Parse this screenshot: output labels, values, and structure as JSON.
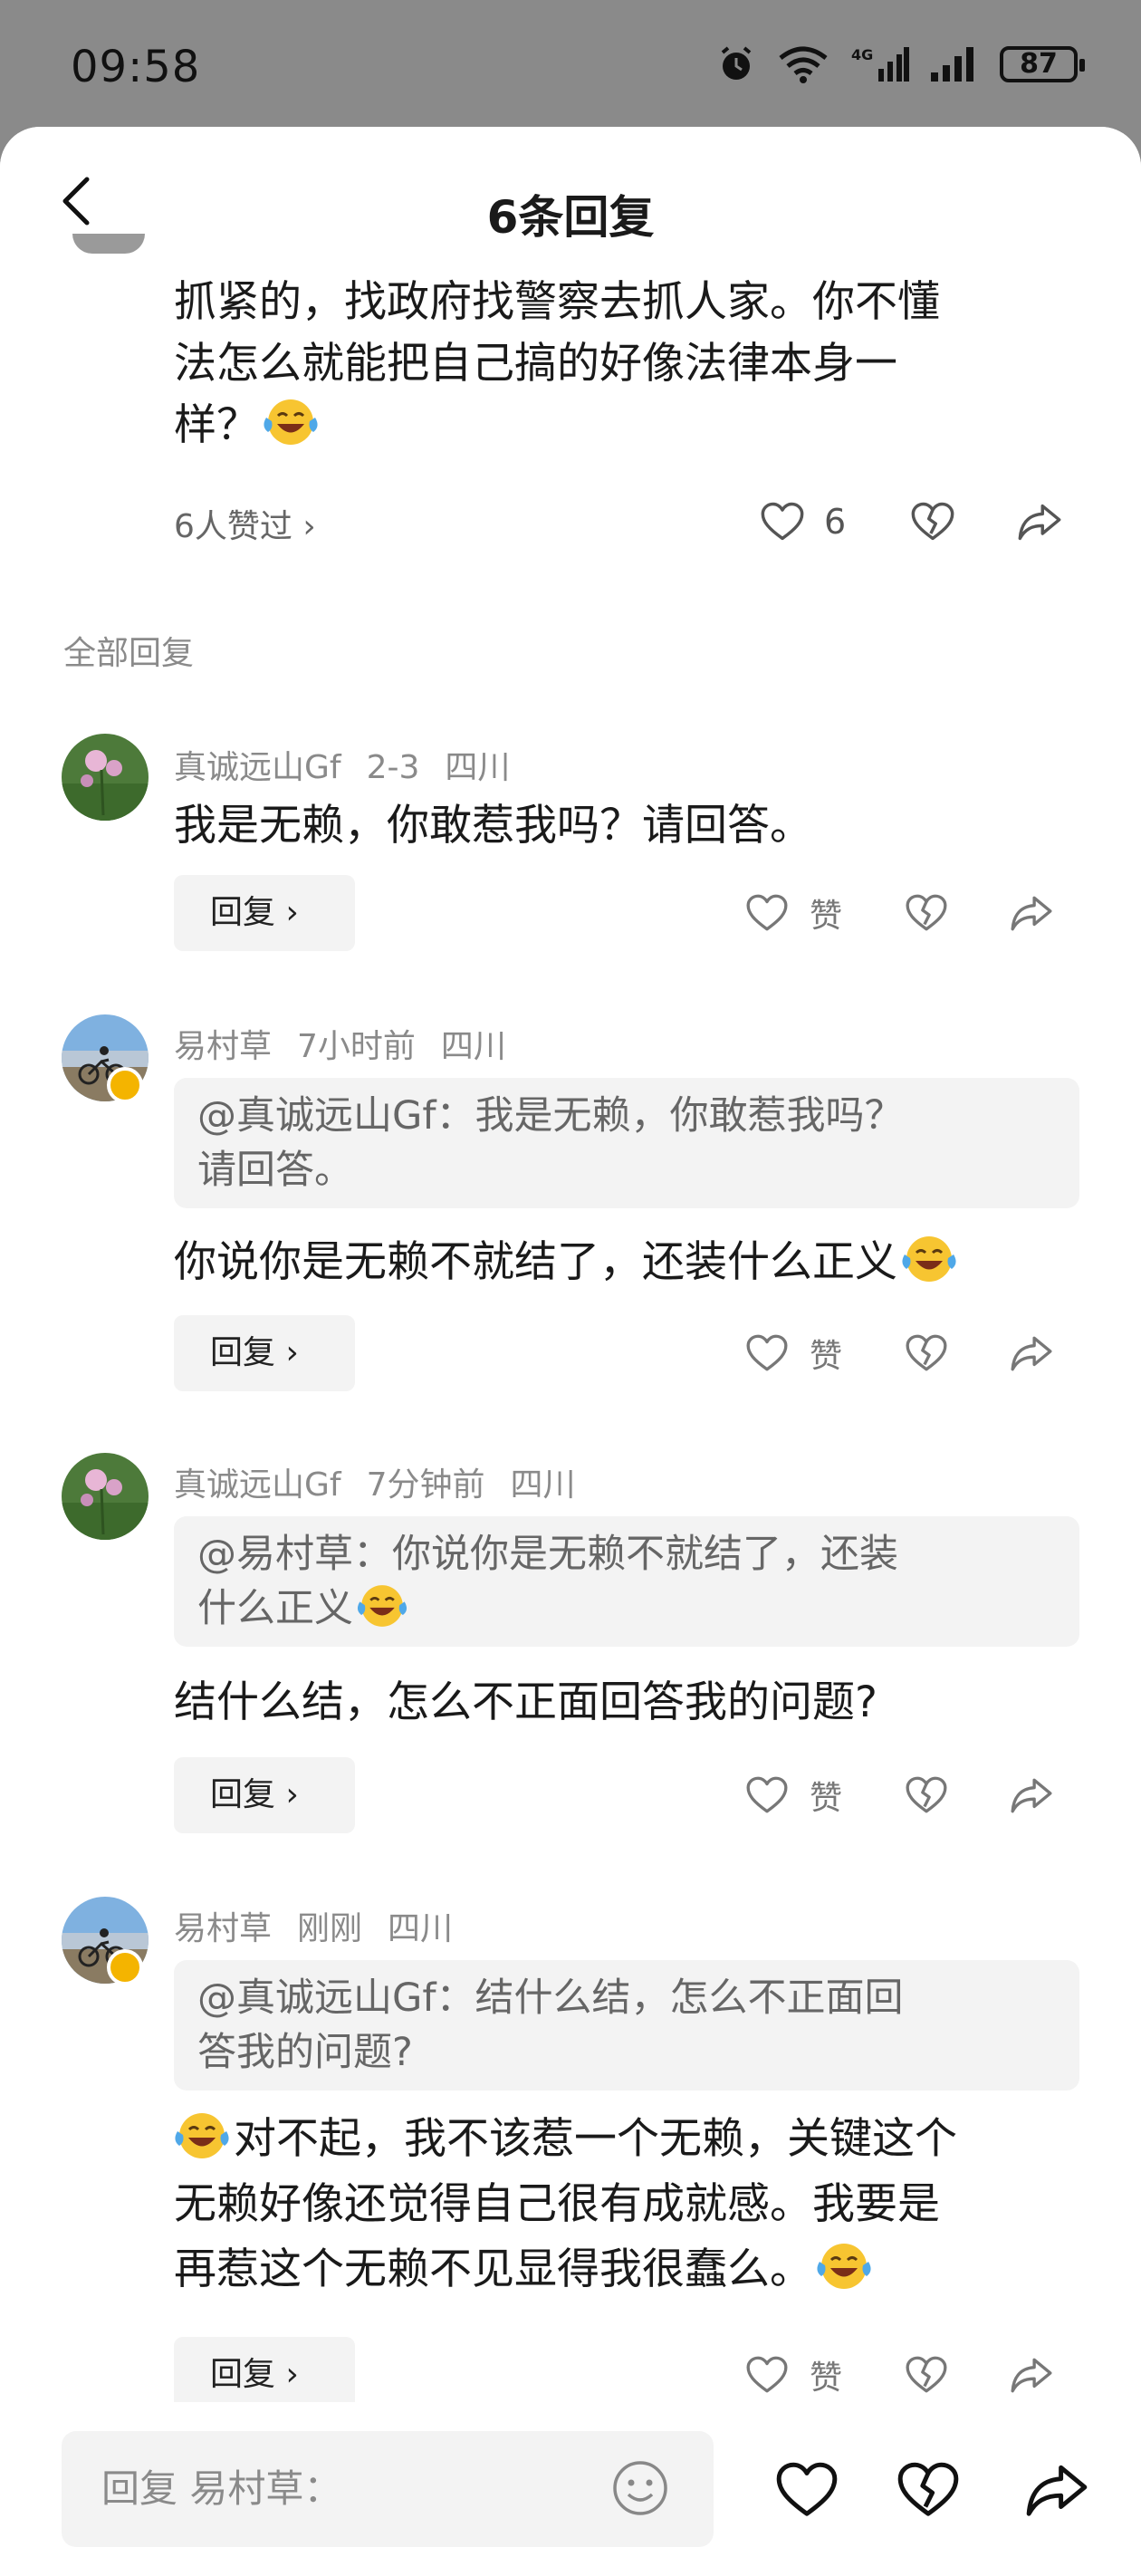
{
  "status": {
    "time": "09:58",
    "battery": "87"
  },
  "header": {
    "title": "6条回复"
  },
  "main_comment": {
    "lines": [
      "抓紧的，找政府找警察去抓人家。你不懂",
      "法怎么就能把自己搞的好像法律本身一",
      "样？"
    ],
    "liked_by": "6人赞过 ›",
    "like_count": "6"
  },
  "section": {
    "label": "全部回复"
  },
  "replies": [
    {
      "user": "真诚远山Gf",
      "time": "2-3",
      "location": "四川",
      "quote": "",
      "text": "我是无赖，你敢惹我吗？请回答。",
      "reply_label": "回复 ›",
      "like_label": "赞"
    },
    {
      "user": "易村草",
      "time": "7小时前",
      "location": "四川",
      "quote_lines": [
        "@真诚远山Gf：我是无赖，你敢惹我吗？",
        "请回答。"
      ],
      "text": "你说你是无赖不就结了，还装什么正义",
      "reply_label": "回复 ›",
      "like_label": "赞"
    },
    {
      "user": "真诚远山Gf",
      "time": "7分钟前",
      "location": "四川",
      "quote_lines": [
        "@易村草：你说你是无赖不就结了，还装",
        "什么正义"
      ],
      "text": "结什么结，怎么不正面回答我的问题?",
      "reply_label": "回复 ›",
      "like_label": "赞"
    },
    {
      "user": "易村草",
      "time": "刚刚",
      "location": "四川",
      "quote_lines": [
        "@真诚远山Gf：结什么结，怎么不正面回",
        "答我的问题?"
      ],
      "text_lines": [
        "对不起，我不该惹一个无赖，关键这个",
        "无赖好像还觉得自己很有成就感。我要是",
        "再惹这个无赖不见显得我很蠢么。"
      ],
      "reply_label": "回复 ›",
      "like_label": "赞"
    }
  ],
  "bottom_bar": {
    "placeholder": "回复 易村草："
  }
}
